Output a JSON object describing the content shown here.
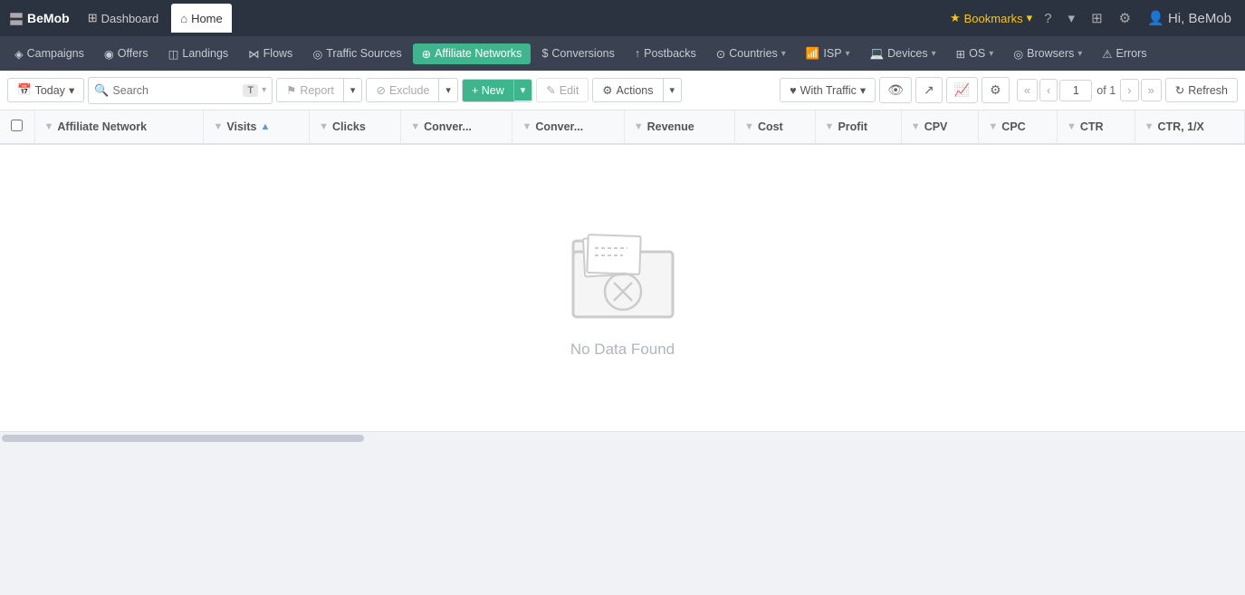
{
  "app": {
    "logo": "BeMob",
    "logo_icon": "〓"
  },
  "top_nav": {
    "tabs": [
      {
        "id": "dashboard",
        "label": "Dashboard",
        "icon": "⊞",
        "active": false
      },
      {
        "id": "home",
        "label": "Home",
        "icon": "⌂",
        "active": true
      }
    ],
    "right": {
      "bookmarks_label": "Bookmarks",
      "help_icon": "?",
      "notifications_icon": "🔔",
      "grid_icon": "⊞",
      "settings_icon": "⚙",
      "user_label": "Hi, BeMob"
    }
  },
  "sub_nav": {
    "items": [
      {
        "id": "campaigns",
        "label": "Campaigns",
        "icon": "◈",
        "has_dropdown": false
      },
      {
        "id": "offers",
        "label": "Offers",
        "icon": "◉",
        "has_dropdown": false
      },
      {
        "id": "landings",
        "label": "Landings",
        "icon": "◫",
        "has_dropdown": false
      },
      {
        "id": "flows",
        "label": "Flows",
        "icon": "⋈",
        "has_dropdown": false
      },
      {
        "id": "traffic-sources",
        "label": "Traffic Sources",
        "icon": "◎",
        "has_dropdown": false
      },
      {
        "id": "affiliate-networks",
        "label": "Affiliate Networks",
        "icon": "⊕",
        "active": true,
        "has_dropdown": false
      },
      {
        "id": "conversions",
        "label": "Conversions",
        "icon": "$",
        "has_dropdown": false
      },
      {
        "id": "postbacks",
        "label": "Postbacks",
        "icon": "↑",
        "has_dropdown": false
      },
      {
        "id": "countries",
        "label": "Countries",
        "icon": "⊙",
        "has_dropdown": true
      },
      {
        "id": "isp",
        "label": "ISP",
        "icon": "📶",
        "has_dropdown": true
      },
      {
        "id": "devices",
        "label": "Devices",
        "icon": "💻",
        "has_dropdown": true
      },
      {
        "id": "os",
        "label": "OS",
        "icon": "⊞",
        "has_dropdown": true
      },
      {
        "id": "browsers",
        "label": "Browsers",
        "icon": "◎",
        "has_dropdown": true
      },
      {
        "id": "errors",
        "label": "Errors",
        "icon": "⚠",
        "has_dropdown": false
      }
    ]
  },
  "toolbar": {
    "today_label": "Today",
    "search_placeholder": "Search",
    "search_t_badge": "T",
    "report_label": "Report",
    "exclude_label": "Exclude",
    "new_label": "+ New",
    "edit_label": "Edit",
    "actions_label": "Actions",
    "with_traffic_label": "With Traffic",
    "page_current": "1",
    "page_of": "of 1",
    "refresh_label": "Refresh"
  },
  "table": {
    "columns": [
      {
        "id": "checkbox",
        "label": ""
      },
      {
        "id": "affiliate-network",
        "label": "Affiliate Network",
        "sortable": true
      },
      {
        "id": "visits",
        "label": "Visits",
        "sortable": true,
        "sort_dir": "asc"
      },
      {
        "id": "clicks",
        "label": "Clicks",
        "sortable": true
      },
      {
        "id": "conversions1",
        "label": "Conver...",
        "sortable": true
      },
      {
        "id": "conversions2",
        "label": "Conver...",
        "sortable": true
      },
      {
        "id": "revenue",
        "label": "Revenue",
        "sortable": true
      },
      {
        "id": "cost",
        "label": "Cost",
        "sortable": true
      },
      {
        "id": "profit",
        "label": "Profit",
        "sortable": true
      },
      {
        "id": "cpv",
        "label": "CPV",
        "sortable": true
      },
      {
        "id": "cpc",
        "label": "CPC",
        "sortable": true
      },
      {
        "id": "ctr",
        "label": "CTR",
        "sortable": true
      },
      {
        "id": "ctr1x",
        "label": "CTR, 1/X",
        "sortable": true
      }
    ],
    "rows": [],
    "no_data_text": "No Data Found"
  }
}
